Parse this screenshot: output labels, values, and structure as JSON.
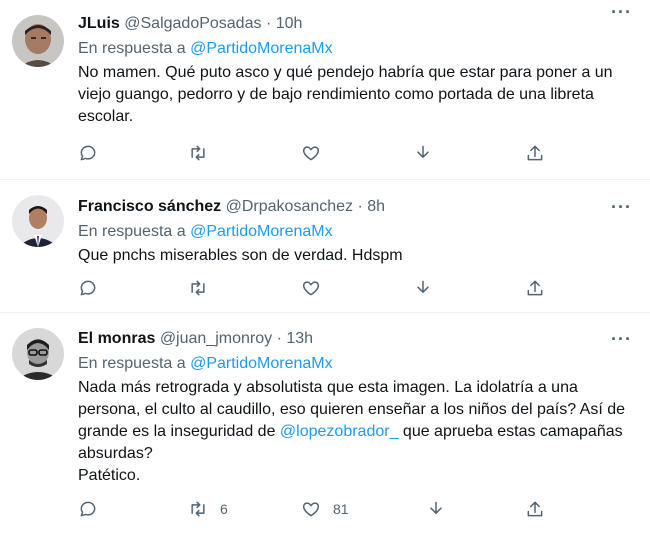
{
  "tweets": [
    {
      "name": "JLuis",
      "handle": "@SalgadoPosadas",
      "time": "10h",
      "reply_prefix": "En respuesta a",
      "reply_to": "@PartidoMorenaMx",
      "text": "No mamen. Qué puto asco y qué pendejo habría que estar para poner a un viejo guango, pedorro y de bajo rendimiento como portada de una libreta escolar.",
      "retweets": "",
      "likes": ""
    },
    {
      "name": "Francisco sánchez",
      "handle": "@Drpakosanchez",
      "time": "8h",
      "reply_prefix": "En respuesta a",
      "reply_to": "@PartidoMorenaMx",
      "text": "Que pnchs miserables son de verdad. Hdspm",
      "retweets": "",
      "likes": ""
    },
    {
      "name": "El monras",
      "handle": "@juan_jmonroy",
      "time": "13h",
      "reply_prefix": "En respuesta a",
      "reply_to": "@PartidoMorenaMx",
      "text_before": "Nada más retrograda y absolutista que esta imagen. La idolatría a una persona, el culto al caudillo, eso quieren enseñar a los niños del país? Así de grande es la inseguridad de ",
      "text_mention": "@lopezobrador_",
      "text_after": " que aprueba estas camapañas absurdas?",
      "text_line2": "Patético.",
      "retweets": "6",
      "likes": "81"
    }
  ],
  "icons": {
    "reply": "reply-icon",
    "retweet": "retweet-icon",
    "like": "heart-icon",
    "download": "download-icon",
    "share": "share-icon",
    "more": "more-icon"
  },
  "colors": {
    "accent": "#1d9bf0",
    "secondary": "#536471",
    "text": "#0f1419",
    "border": "#eff3f4"
  }
}
